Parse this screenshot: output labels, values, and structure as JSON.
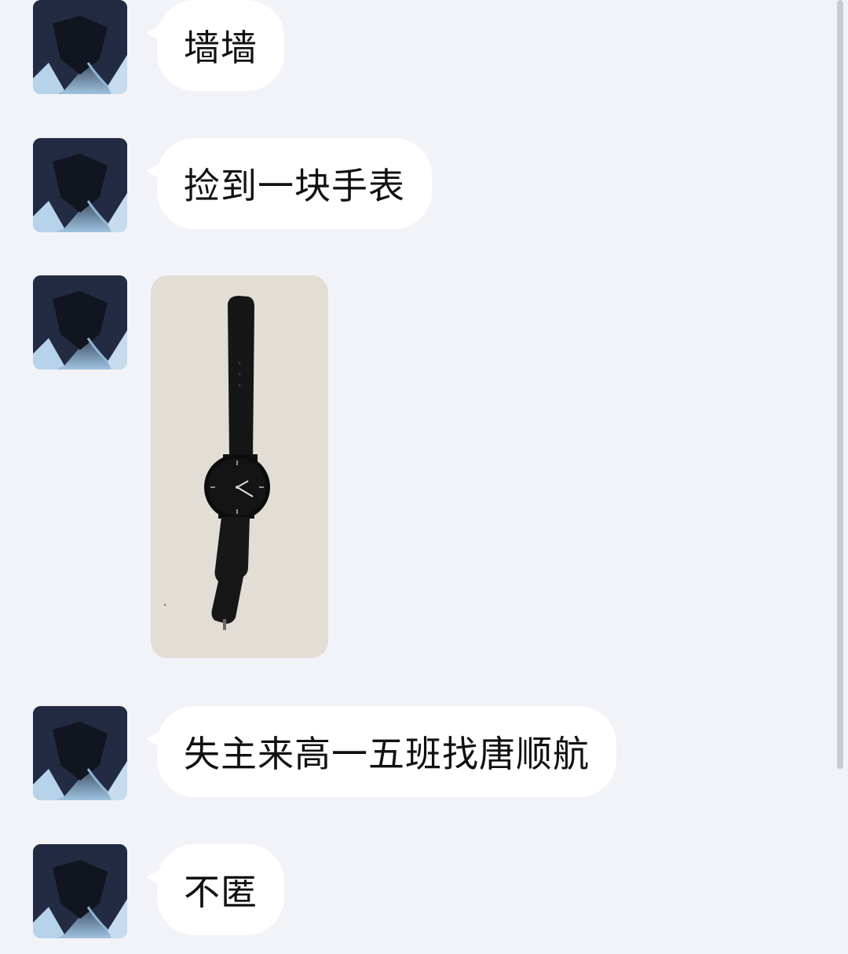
{
  "messages": [
    {
      "type": "text",
      "text": "墙墙"
    },
    {
      "type": "text",
      "text": "捡到一块手表"
    },
    {
      "type": "image"
    },
    {
      "type": "text",
      "text": "失主来高一五班找唐顺航"
    },
    {
      "type": "text",
      "text": "不匿"
    }
  ],
  "colors": {
    "background": "#f2f3f8",
    "bubble": "#ffffff",
    "text": "#111111"
  }
}
